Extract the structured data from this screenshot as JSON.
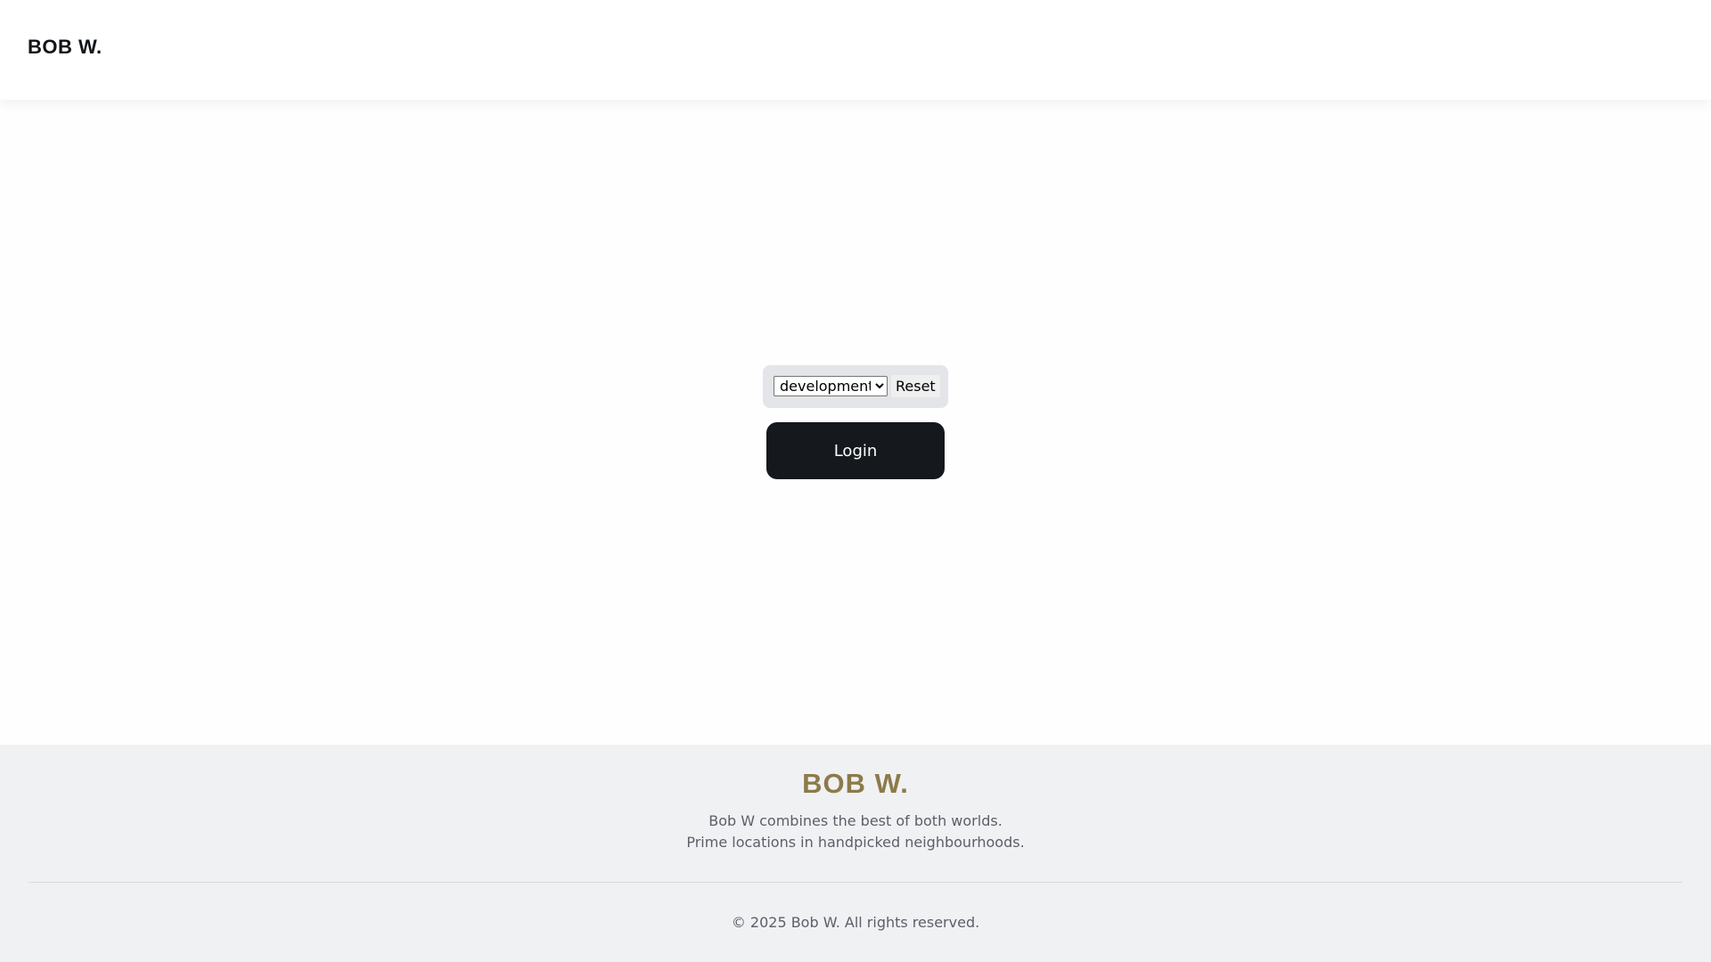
{
  "header": {
    "logo": "BOB W."
  },
  "environment": {
    "selected": "development",
    "options": [
      "development"
    ],
    "reset_label": "Reset"
  },
  "login": {
    "label": "Login"
  },
  "footer": {
    "logo": "BOB W.",
    "tagline_line1": "Bob W combines the best of both worlds.",
    "tagline_line2": "Prime locations in handpicked neighbourhoods.",
    "copyright": "© 2025 Bob W. All rights reserved."
  },
  "colors": {
    "brand_gold": "#8c7a4a",
    "login_button": "#15191d",
    "footer_background": "#f0f1f3"
  }
}
